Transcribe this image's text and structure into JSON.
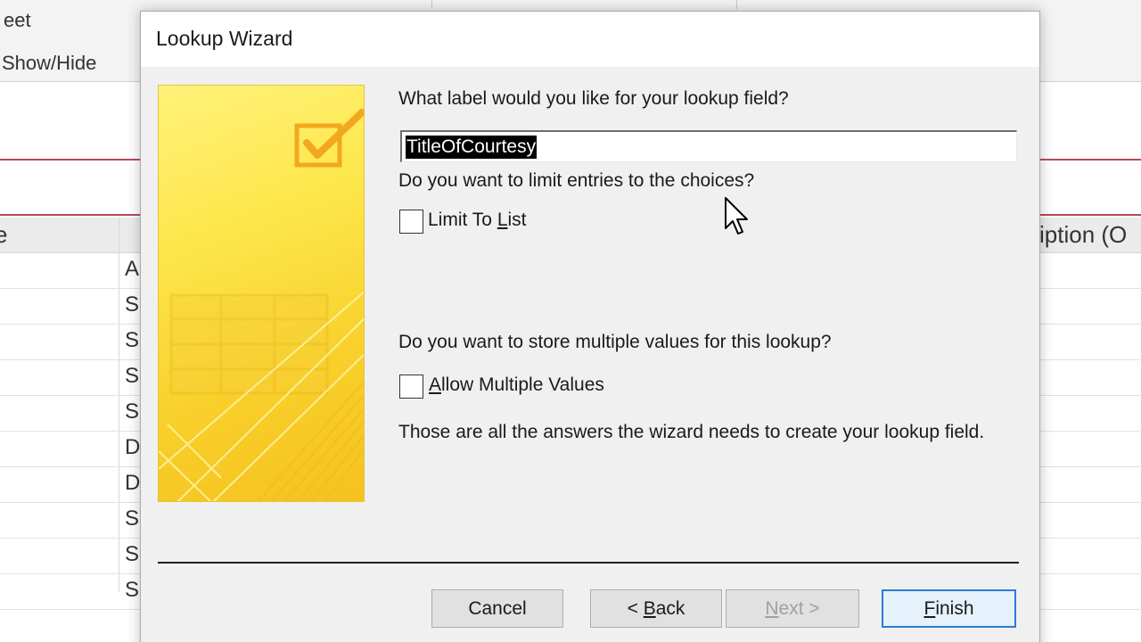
{
  "background": {
    "ribbon_group_1": "eet",
    "ribbon_group_2": "Show/Hide",
    "column_partial_left": "e",
    "column_partial_right": "iption (O",
    "rows": [
      "A",
      "S",
      "S",
      "S",
      "S",
      "D",
      "D",
      "S",
      "S",
      "S"
    ]
  },
  "dialog": {
    "title": "Lookup Wizard",
    "question_label": "What label would you like for your lookup field?",
    "label_value": "TitleOfCourtesy",
    "question_limit": "Do you want to limit entries to the choices?",
    "limit_to_list": {
      "label_pre": "Limit To ",
      "label_accel": "L",
      "label_post": "ist",
      "checked": false
    },
    "question_multiple": "Do you want to store multiple values for this lookup?",
    "allow_multiple": {
      "label_pre": "",
      "label_accel": "A",
      "label_post": "llow Multiple Values",
      "checked": false
    },
    "summary": "Those are all the answers the wizard needs to create your lookup field.",
    "buttons": {
      "cancel": "Cancel",
      "back": {
        "pre": "< ",
        "accel": "B",
        "post": "ack"
      },
      "next": {
        "pre": "",
        "accel": "N",
        "post": "ext >"
      },
      "finish": {
        "pre": "",
        "accel": "F",
        "post": "inish"
      }
    }
  },
  "colors": {
    "art_yellow": "#fde64a",
    "selection": "#000000",
    "default_button_border": "#2b7cd3",
    "background_red_rule": "#b94a5a"
  }
}
